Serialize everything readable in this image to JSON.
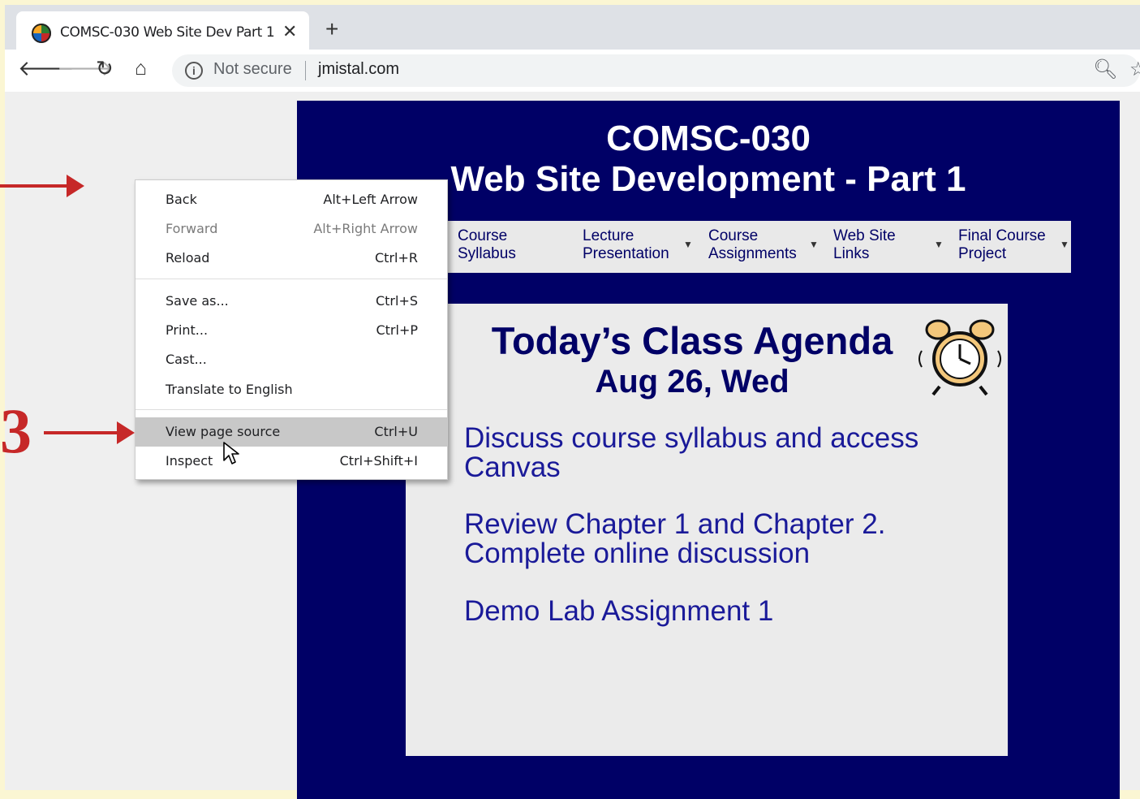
{
  "browser": {
    "tab_title": "COMSC-030 Web Site Dev Part 1",
    "tab_close": "✕",
    "new_tab": "+",
    "security_label": "Not secure",
    "url": "jmistal.com"
  },
  "site": {
    "title": "COMSC-030",
    "subtitle": "Web Site Development - Part 1",
    "menu": [
      {
        "line1": "Course",
        "line2": "Syllabus",
        "has_dropdown": false
      },
      {
        "line1": "Lecture",
        "line2": "Presentation",
        "has_dropdown": true
      },
      {
        "line1": "Course",
        "line2": "Assignments",
        "has_dropdown": true
      },
      {
        "line1": "Web Site",
        "line2": "Links",
        "has_dropdown": true
      },
      {
        "line1": "Final Course",
        "line2": "Project",
        "has_dropdown": true
      }
    ],
    "agenda": {
      "title": "Today’s Class Agenda",
      "date": "Aug 26, Wed",
      "items": [
        {
          "line1": "Discuss course syllabus and access",
          "line2": "Canvas"
        },
        {
          "line1": "Review Chapter 1 and Chapter 2.",
          "line2": "Complete online discussion"
        },
        {
          "line1": "Demo Lab Assignment 1",
          "line2": ""
        }
      ]
    }
  },
  "context_menu": {
    "groups": [
      [
        {
          "label": "Back",
          "shortcut": "Alt+Left Arrow",
          "disabled": false
        },
        {
          "label": "Forward",
          "shortcut": "Alt+Right Arrow",
          "disabled": true
        },
        {
          "label": "Reload",
          "shortcut": "Ctrl+R",
          "disabled": false
        }
      ],
      [
        {
          "label": "Save as...",
          "shortcut": "Ctrl+S",
          "disabled": false
        },
        {
          "label": "Print...",
          "shortcut": "Ctrl+P",
          "disabled": false
        },
        {
          "label": "Cast...",
          "shortcut": "",
          "disabled": false
        },
        {
          "label": "Translate to English",
          "shortcut": "",
          "disabled": false
        }
      ],
      [
        {
          "label": "View page source",
          "shortcut": "Ctrl+U",
          "disabled": false,
          "highlighted": true
        },
        {
          "label": "Inspect",
          "shortcut": "Ctrl+Shift+I",
          "disabled": false
        }
      ]
    ]
  },
  "annotations": {
    "step_number": "3",
    "arrow_color": "#c62828"
  },
  "colors": {
    "site_background": "#000066",
    "page_frame": "#fbf6d3"
  }
}
